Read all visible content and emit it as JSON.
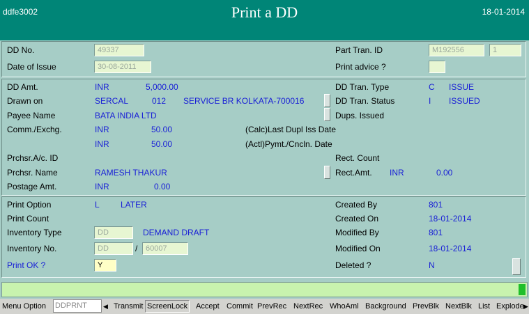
{
  "header": {
    "screen_code": "ddfe3002",
    "title": "Print a DD",
    "date": "18-01-2014"
  },
  "section1": {
    "dd_no_label": "DD No.",
    "dd_no_value": "49337",
    "date_issue_label": "Date of Issue",
    "date_issue_value": "30-08-2011",
    "part_tran_label": "Part Tran. ID",
    "part_tran_value": "M192556",
    "part_tran_seq": "1",
    "print_advice_label": "Print advice ?",
    "print_advice_value": ""
  },
  "section2": {
    "dd_amt_label": "DD Amt.",
    "dd_amt_ccy": "INR",
    "dd_amt_value": "5,000.00",
    "drawn_on_label": "Drawn on",
    "drawn_on_bank": "SERCAL",
    "drawn_on_code": "012",
    "drawn_on_branch": "SERVICE BR KOLKATA-700016",
    "payee_label": "Payee Name",
    "payee_value": "BATA INDIA LTD",
    "comm_label": "Comm./Exchg.",
    "comm1_ccy": "INR",
    "comm1_value": "50.00",
    "comm2_ccy": "INR",
    "comm2_value": "50.00",
    "calc_label": "(Calc)Last Dupl Iss Date",
    "actl_label": "(Actl)Pymt./Cncln. Date",
    "tran_type_label": "DD Tran. Type",
    "tran_type_code": "C",
    "tran_type_desc": "ISSUE",
    "tran_status_label": "DD Tran. Status",
    "tran_status_code": "I",
    "tran_status_desc": "ISSUED",
    "dups_label": "Dups. Issued",
    "prchsr_ac_label": "Prchsr.A/c. ID",
    "rect_count_label": "Rect. Count",
    "prchsr_name_label": "Prchsr. Name",
    "prchsr_name_value": "RAMESH THAKUR",
    "rect_amt_label": "Rect.Amt.",
    "rect_amt_ccy": "INR",
    "rect_amt_value": "0.00",
    "postage_label": "Postage Amt.",
    "postage_ccy": "INR",
    "postage_value": "0.00"
  },
  "section3": {
    "print_option_label": "Print Option",
    "print_option_code": "L",
    "print_option_desc": "LATER",
    "print_count_label": "Print Count",
    "inv_type_label": "Inventory Type",
    "inv_type_value": "DD",
    "inv_type_desc": "DEMAND DRAFT",
    "inv_no_label": "Inventory No.",
    "inv_no_prefix": "DD",
    "inv_no_sep": "/",
    "inv_no_value": "60007",
    "print_ok_label": "Print OK ?",
    "print_ok_value": "Y",
    "created_by_label": "Created By",
    "created_by_value": "801",
    "created_on_label": "Created On",
    "created_on_value": "18-01-2014",
    "modified_by_label": "Modified By",
    "modified_by_value": "801",
    "modified_on_label": "Modified On",
    "modified_on_value": "18-01-2014",
    "deleted_label": "Deleted ?",
    "deleted_value": "N"
  },
  "toolbar": {
    "menu_option_label": "Menu Option",
    "menu_field_value": "DDPRNT",
    "left_arrow": "◀",
    "right_arrow": "▶",
    "buttons": [
      "Transmit",
      "ScreenLock",
      "Accept",
      "Commit",
      "PrevRec",
      "NextRec",
      "WhoAml",
      "Background",
      "PrevBlk",
      "NextBlk",
      "List",
      "Explode"
    ]
  },
  "colors": {
    "header": "#008577",
    "body": "#a6cdc6",
    "field": "#e7f6d2",
    "active_field": "#ffffc6",
    "value_text": "#1a20d6",
    "status_bar": "#c8f3ae",
    "led": "#1fbf2a"
  }
}
